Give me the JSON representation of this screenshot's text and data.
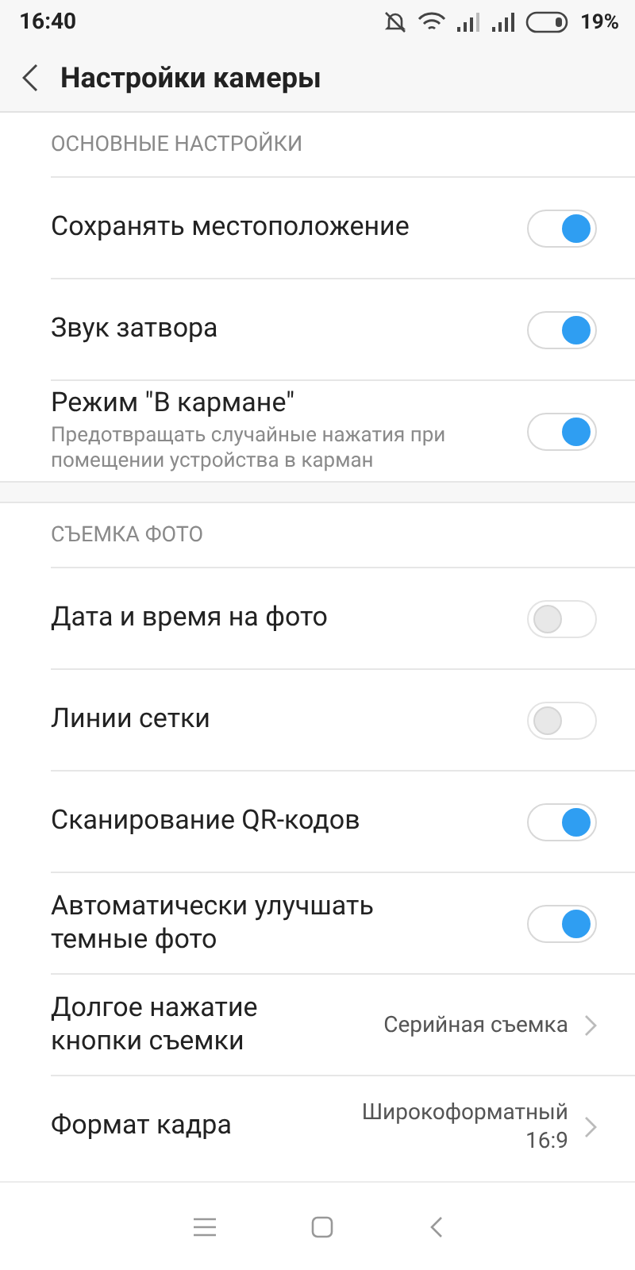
{
  "status_bar": {
    "time": "16:40",
    "battery": "19%"
  },
  "header": {
    "title": "Настройки камеры"
  },
  "sections": [
    {
      "title": "ОСНОВНЫЕ НАСТРОЙКИ",
      "rows": [
        {
          "kind": "toggle",
          "label": "Сохранять местоположение",
          "on": true
        },
        {
          "kind": "toggle",
          "label": "Звук затвора",
          "on": true
        },
        {
          "kind": "toggle",
          "label": "Режим \"В кармане\"",
          "subtitle": "Предотвращать случайные нажатия при помещении устройства в карман",
          "on": true
        }
      ]
    },
    {
      "title": "СЪЕМКА ФОТО",
      "rows": [
        {
          "kind": "toggle",
          "label": "Дата и время на фото",
          "on": false
        },
        {
          "kind": "toggle",
          "label": "Линии сетки",
          "on": false
        },
        {
          "kind": "toggle",
          "label": "Сканирование QR-кодов",
          "on": true
        },
        {
          "kind": "toggle",
          "label": "Автоматически улучшать темные фото",
          "on": true
        },
        {
          "kind": "value",
          "label": "Долгое нажатие кнопки съемки",
          "value": "Серийная съемка"
        },
        {
          "kind": "value",
          "label": "Формат кадра",
          "value": "Широкоформатный 16:9"
        }
      ]
    }
  ]
}
